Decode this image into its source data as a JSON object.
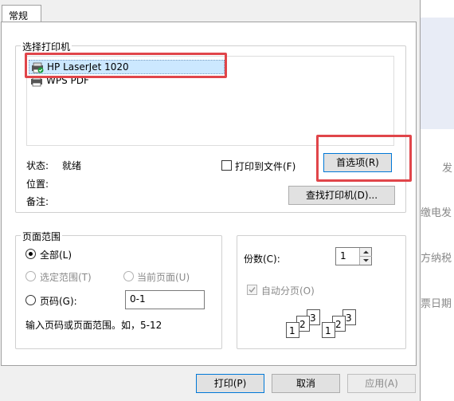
{
  "tab": {
    "label": "常规"
  },
  "printer_group": {
    "label": "选择打印机"
  },
  "printers": [
    {
      "name": "HP LaserJet 1020",
      "selected": true,
      "icon": "printer-default-icon"
    },
    {
      "name": "WPS PDF",
      "selected": false,
      "icon": "printer-icon"
    }
  ],
  "status": {
    "state_label": "状态:",
    "state_value": "就绪",
    "location_label": "位置:",
    "comment_label": "备注:"
  },
  "print_to_file": {
    "label": "打印到文件(F)",
    "checked": false
  },
  "buttons": {
    "preferences": "首选项(R)",
    "find_printer": "查找打印机(D)...",
    "print": "打印(P)",
    "cancel": "取消",
    "apply": "应用(A)"
  },
  "range_group": {
    "label": "页面范围",
    "all": "全部(L)",
    "selection": "选定范围(T)",
    "current_page": "当前页面(U)",
    "pages": "页码(G):",
    "pages_value": "0-1",
    "hint": "输入页码或页面范围。如，5-12"
  },
  "copies": {
    "label": "份数(C):",
    "value": "1",
    "collate_label": "自动分页(O)",
    "collate_checked": true
  },
  "background_text": [
    "发",
    "缴电发",
    "方纳税",
    "票日期"
  ],
  "colors": {
    "highlight": "#e0454a",
    "selection": "#cce8ff"
  }
}
